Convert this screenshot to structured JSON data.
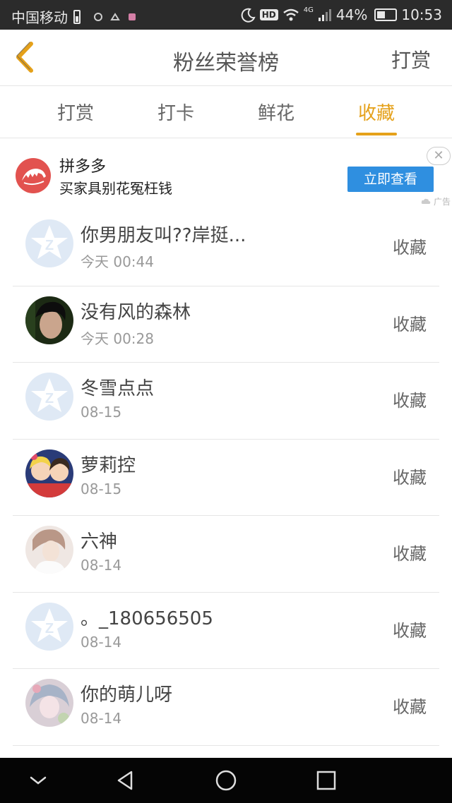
{
  "status_bar": {
    "carrier": "中国移动",
    "hd": "HD",
    "network": "4G",
    "battery": "44%",
    "time": "10:53"
  },
  "header": {
    "title": "粉丝荣誉榜",
    "action": "打赏"
  },
  "tabs": [
    {
      "label": "打赏",
      "active": false
    },
    {
      "label": "打卡",
      "active": false
    },
    {
      "label": "鲜花",
      "active": false
    },
    {
      "label": "收藏",
      "active": true
    }
  ],
  "ad": {
    "title": "拼多多",
    "description": "买家具别花冤枉钱",
    "button": "立即查看",
    "close": "✕",
    "tag": "广告"
  },
  "list": [
    {
      "name": "你男朋友叫??岸挺...",
      "time": "今天 00:44",
      "action": "收藏",
      "avatar": "qq-default-avatar"
    },
    {
      "name": "没有风的森林",
      "time": "今天 00:28",
      "action": "收藏",
      "avatar": "photo-avatar-dark"
    },
    {
      "name": "冬雪点点",
      "time": "08-15",
      "action": "收藏",
      "avatar": "qq-default-avatar"
    },
    {
      "name": "萝莉控",
      "time": "08-15",
      "action": "收藏",
      "avatar": "anime-avatar"
    },
    {
      "name": "六神",
      "time": "08-14",
      "action": "收藏",
      "avatar": "photo-avatar-light"
    },
    {
      "name": "。_180656505",
      "time": "08-14",
      "action": "收藏",
      "avatar": "qq-default-avatar"
    },
    {
      "name": "你的萌儿呀",
      "time": "08-14",
      "action": "收藏",
      "avatar": "anime-avatar-pastel"
    }
  ],
  "colors": {
    "accent": "#e5a11a",
    "ad_button": "#2f8fe0",
    "ad_logo": "#e2524f"
  }
}
